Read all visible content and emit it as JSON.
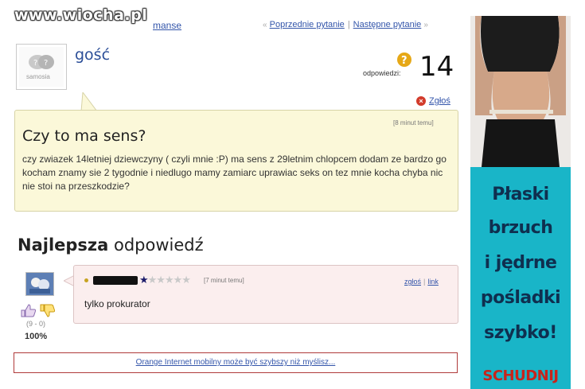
{
  "watermark": {
    "text": "www.wiocha.pl"
  },
  "breadcrumb": {
    "tail": "manse"
  },
  "nav": {
    "prev": "Poprzednie pytanie",
    "separator": "|",
    "next": "Następne pytanie",
    "arrow_left": "«",
    "arrow_right": "»"
  },
  "asker": {
    "name": "gość",
    "avatar_caption": "samosia"
  },
  "answers": {
    "label": "odpowiedzi:",
    "count": "14",
    "badge_icon": "question-badge-icon"
  },
  "report": {
    "label": "Zgłoś"
  },
  "question": {
    "time": "[8 minut temu]",
    "title": "Czy to ma sens?",
    "body": "czy zwiazek 14letniej dziewczyny ( czyli mnie :P) ma sens z 29letnim chlopcem dodam ze bardzo go kocham znamy sie 2 tygodnie i niedlugo mamy zamiarc uprawiac seks on tez mnie kocha chyba nic nie stoi na przeszkodzie?"
  },
  "best_answer": {
    "heading_bold": "Najlepsza",
    "heading_rest": " odpowiedź",
    "time": "[7 minut temu]",
    "links": {
      "report": "zgłoś",
      "separator": "|",
      "link": "link"
    },
    "text": "tylko prokurator",
    "votes": "(9 - 0)",
    "percent": "100%",
    "rating": 1
  },
  "ad_bar": {
    "text": "Orange Internet mobilny może być szybszy niż myślisz..."
  },
  "side_ad": {
    "lines": [
      "Płaski",
      "brzuch",
      "i jędrne",
      "pośladki",
      "szybko!"
    ],
    "cta": "SCHUDNIJ",
    "colors": {
      "panel": "#19b5c8",
      "text": "#0f2f4f",
      "cta": "#c8241b"
    }
  },
  "colors": {
    "link": "#3355aa",
    "question_bg": "#fbf8d9",
    "answer_bg": "#fbeeee",
    "asker": "#2b4e98"
  }
}
